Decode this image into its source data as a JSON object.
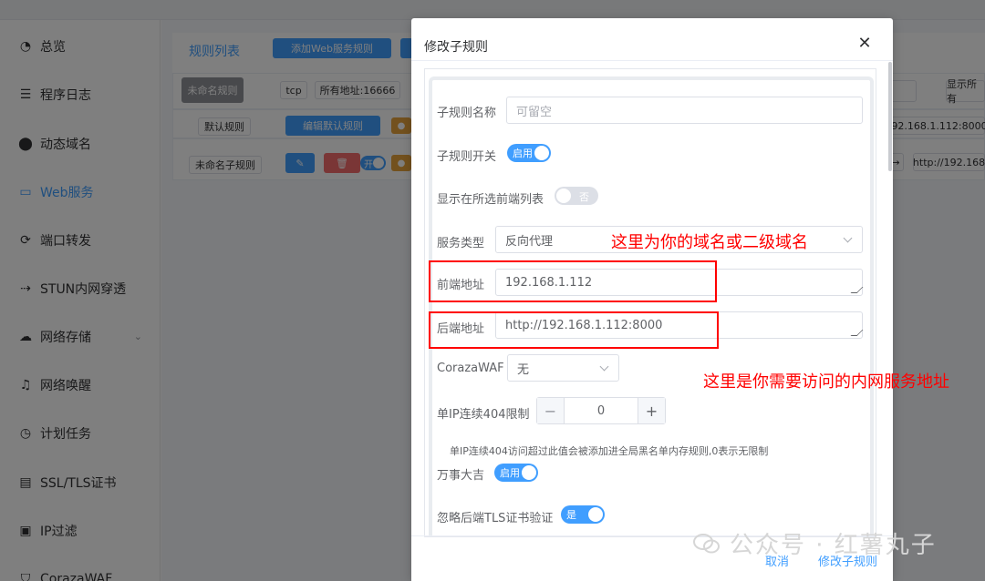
{
  "sidebar": {
    "items": [
      {
        "label": "总览",
        "icon": "dashboard-icon"
      },
      {
        "label": "程序日志",
        "icon": "log-icon"
      },
      {
        "label": "动态域名",
        "icon": "ddns-icon"
      },
      {
        "label": "Web服务",
        "icon": "web-service-icon",
        "active": true
      },
      {
        "label": "端口转发",
        "icon": "port-forward-icon"
      },
      {
        "label": "STUN内网穿透",
        "icon": "stun-icon"
      },
      {
        "label": "网络存储",
        "icon": "cloud-storage-icon"
      },
      {
        "label": "网络唤醒",
        "icon": "bell-icon"
      },
      {
        "label": "计划任务",
        "icon": "clock-icon"
      },
      {
        "label": "SSL/TLS证书",
        "icon": "certificate-icon"
      },
      {
        "label": "IP过滤",
        "icon": "filter-icon"
      },
      {
        "label": "CorazaWAF",
        "icon": "shield-icon"
      }
    ]
  },
  "background": {
    "tab_label": "规则列表",
    "add_rule_button": "添加Web服务规则",
    "unnamed_rule": "未命名规则",
    "proto_chip": "tcp",
    "address_chip": "所有地址:16666",
    "show_all_chip": "显示所有",
    "default_rule": "默认规则",
    "edit_default_button": "编辑默认规则",
    "unnamed_subrule": "未命名子规则",
    "toggle_on": "开",
    "backend_chip_1": "192.168.1.112:8000",
    "backend_chip_2": "http://192.168"
  },
  "dialog": {
    "title": "修改子规则",
    "fields": {
      "subrule_name_label": "子规则名称",
      "subrule_name_placeholder": "可留空",
      "subrule_switch_label": "子规则开关",
      "subrule_switch_text": "启用",
      "show_in_frontend_label": "显示在所选前端列表",
      "show_in_frontend_text": "否",
      "service_type_label": "服务类型",
      "service_type_value": "反向代理",
      "frontend_address_label": "前端地址",
      "frontend_address_value": "192.168.1.112",
      "backend_address_label": "后端地址",
      "backend_address_value": "http://192.168.1.112:8000",
      "coraza_label": "CorazaWAF",
      "coraza_value": "无",
      "ip_limit_label": "单IP连续404限制",
      "ip_limit_value": "0",
      "ip_limit_hint": "单IP连续404访问超过此值会被添加进全局黑名单内存规则,0表示无限制",
      "lucky_label": "万事大吉",
      "lucky_text": "启用",
      "ignore_tls_label": "忽略后端TLS证书验证",
      "ignore_tls_text": "是"
    },
    "footer": {
      "cancel": "取消",
      "confirm": "修改子规则"
    }
  },
  "annotations": {
    "domain_note": "这里为你的域名或二级域名",
    "backend_note": "这里是你需要访问的内网服务地址"
  },
  "watermark": {
    "text": "公众号 · 红薯丸子"
  },
  "colors": {
    "primary": "#409eff",
    "annotation": "#ff0000",
    "overlay": "rgba(0,0,0,0.5)"
  }
}
